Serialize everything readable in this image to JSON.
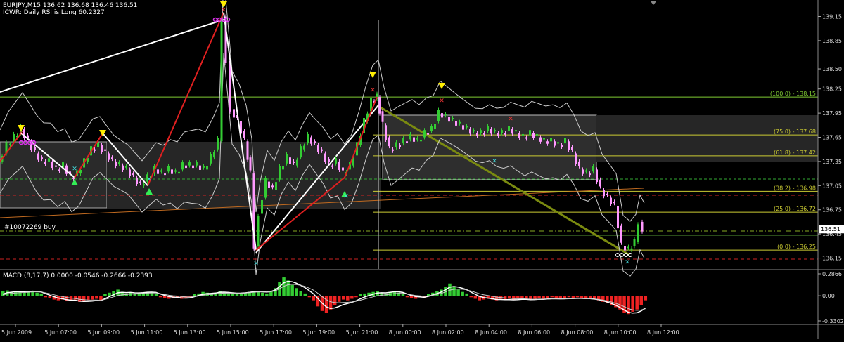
{
  "header": {
    "symbol_line": "EURJPY,M15  136.62 136.68 136.46 136.51",
    "indicator_line": "ICWR: Daily RSI is Long 60.2327",
    "order_label": "#10072269 buy"
  },
  "price_axis": {
    "ticks": [
      "139.15",
      "138.85",
      "138.50",
      "138.25",
      "137.95",
      "137.65",
      "137.35",
      "137.05",
      "136.75",
      "136.45",
      "136.15"
    ],
    "current_price": "136.51",
    "range": [
      136.05,
      139.32
    ]
  },
  "fib_levels": [
    {
      "label": "(100.0) - 138.15",
      "value": 138.15,
      "color": "#7fcc33"
    },
    {
      "label": "(75.0) - 137.68",
      "value": 137.68,
      "color": "#cccc33"
    },
    {
      "label": "(61.8) - 137.42",
      "value": 137.42,
      "color": "#cccc33"
    },
    {
      "label": "(38.2) - 136.98",
      "value": 136.98,
      "color": "#cccc33"
    },
    {
      "label": "(25.0) - 136.72",
      "value": 136.72,
      "color": "#cccc33"
    },
    {
      "label": "(0.0) - 136.25",
      "value": 136.25,
      "color": "#cccc33"
    }
  ],
  "macd": {
    "label": "MACD  (8,17,7) 0.0000 -0.0546 -0.2666 -0.2393",
    "ticks": [
      "0.2866",
      "0.00",
      "-0.3302"
    ],
    "range": [
      -0.3302,
      0.2866
    ]
  },
  "time_axis": {
    "labels": [
      "5 Jun 2009",
      "5 Jun 07:00",
      "5 Jun 09:00",
      "5 Jun 11:00",
      "5 Jun 13:00",
      "5 Jun 15:00",
      "5 Jun 17:00",
      "5 Jun 19:00",
      "5 Jun 21:00",
      "8 Jun 00:00",
      "8 Jun 02:00",
      "8 Jun 04:00",
      "8 Jun 06:00",
      "8 Jun 08:00",
      "8 Jun 10:00",
      "8 Jun 12:00"
    ]
  },
  "colors": {
    "background": "#000000",
    "bull_candle": "#33cc33",
    "bear_candle": "#ff99ff",
    "zigzag_up": "#ffffff",
    "zigzag_down": "#e02020",
    "macd_pos": "#33cc33",
    "macd_neg": "#ee2222",
    "arrow_down": "#ffee00",
    "arrow_up": "#33ee55",
    "marker_cross": "#44dddd"
  },
  "chart_data": {
    "type": "candlestick",
    "symbol": "EURJPY",
    "timeframe": "M15",
    "ohlc_last": {
      "open": 136.62,
      "high": 136.68,
      "low": 136.46,
      "close": 136.51
    },
    "close_path": [
      [
        0,
        137.35
      ],
      [
        12,
        137.55
      ],
      [
        22,
        137.65
      ],
      [
        32,
        137.75
      ],
      [
        42,
        137.6
      ],
      [
        52,
        137.45
      ],
      [
        62,
        137.35
      ],
      [
        72,
        137.35
      ],
      [
        82,
        137.25
      ],
      [
        92,
        137.3
      ],
      [
        102,
        137.15
      ],
      [
        112,
        137.2
      ],
      [
        122,
        137.35
      ],
      [
        132,
        137.5
      ],
      [
        142,
        137.55
      ],
      [
        152,
        137.45
      ],
      [
        162,
        137.35
      ],
      [
        172,
        137.3
      ],
      [
        182,
        137.25
      ],
      [
        192,
        137.15
      ],
      [
        202,
        137.05
      ],
      [
        212,
        137.15
      ],
      [
        222,
        137.25
      ],
      [
        232,
        137.2
      ],
      [
        242,
        137.25
      ],
      [
        252,
        137.2
      ],
      [
        262,
        137.3
      ],
      [
        272,
        137.3
      ],
      [
        282,
        137.3
      ],
      [
        292,
        137.25
      ],
      [
        302,
        137.4
      ],
      [
        312,
        137.6
      ],
      [
        318,
        139.15
      ],
      [
        324,
        138.6
      ],
      [
        330,
        138.0
      ],
      [
        340,
        137.85
      ],
      [
        350,
        137.6
      ],
      [
        358,
        137.2
      ],
      [
        364,
        136.3
      ],
      [
        370,
        136.7
      ],
      [
        380,
        137.1
      ],
      [
        390,
        137.0
      ],
      [
        400,
        137.25
      ],
      [
        410,
        137.4
      ],
      [
        420,
        137.3
      ],
      [
        430,
        137.5
      ],
      [
        440,
        137.65
      ],
      [
        450,
        137.55
      ],
      [
        460,
        137.45
      ],
      [
        470,
        137.3
      ],
      [
        480,
        137.35
      ],
      [
        490,
        137.2
      ],
      [
        500,
        137.3
      ],
      [
        510,
        137.55
      ],
      [
        520,
        137.85
      ],
      [
        530,
        138.1
      ],
      [
        538,
        138.15
      ],
      [
        546,
        137.8
      ],
      [
        556,
        137.5
      ],
      [
        566,
        137.55
      ],
      [
        576,
        137.6
      ],
      [
        586,
        137.65
      ],
      [
        596,
        137.6
      ],
      [
        606,
        137.7
      ],
      [
        616,
        137.75
      ],
      [
        626,
        137.95
      ],
      [
        636,
        137.9
      ],
      [
        646,
        137.85
      ],
      [
        656,
        137.8
      ],
      [
        666,
        137.75
      ],
      [
        676,
        137.7
      ],
      [
        686,
        137.7
      ],
      [
        696,
        137.75
      ],
      [
        706,
        137.7
      ],
      [
        716,
        137.7
      ],
      [
        726,
        137.75
      ],
      [
        736,
        137.7
      ],
      [
        746,
        137.65
      ],
      [
        756,
        137.7
      ],
      [
        766,
        137.65
      ],
      [
        776,
        137.6
      ],
      [
        786,
        137.6
      ],
      [
        796,
        137.55
      ],
      [
        806,
        137.6
      ],
      [
        816,
        137.45
      ],
      [
        826,
        137.25
      ],
      [
        836,
        137.2
      ],
      [
        846,
        137.25
      ],
      [
        856,
        137.0
      ],
      [
        866,
        136.9
      ],
      [
        876,
        136.8
      ],
      [
        886,
        136.3
      ],
      [
        896,
        136.25
      ],
      [
        904,
        136.35
      ],
      [
        910,
        136.6
      ],
      [
        916,
        136.51
      ]
    ],
    "zigzag": [
      [
        0,
        137.35
      ],
      [
        30,
        137.7
      ],
      [
        106,
        137.15
      ],
      [
        146,
        137.7
      ],
      [
        210,
        137.05
      ],
      [
        318,
        139.2
      ],
      [
        364,
        136.25
      ],
      [
        490,
        137.15
      ],
      [
        536,
        138.15
      ]
    ],
    "macd_hist": [
      0.06,
      0.07,
      0.05,
      0.06,
      0.05,
      0.04,
      0.05,
      0.06,
      0.04,
      0.03,
      -0.02,
      -0.03,
      -0.05,
      -0.06,
      -0.05,
      -0.07,
      -0.06,
      -0.05,
      -0.08,
      -0.07,
      -0.06,
      -0.05,
      -0.04,
      -0.06,
      0.02,
      0.04,
      0.06,
      0.08,
      0.05,
      0.03,
      0.04,
      0.02,
      0.03,
      0.04,
      0.05,
      0.04,
      0.03,
      -0.02,
      -0.03,
      -0.04,
      -0.03,
      -0.02,
      -0.04,
      -0.03,
      -0.02,
      0.02,
      0.03,
      0.05,
      0.04,
      0.03,
      0.04,
      0.06,
      0.04,
      0.03,
      0.02,
      0.02,
      0.03,
      0.04,
      0.05,
      0.06,
      0.05,
      0.04,
      0.03,
      0.06,
      0.1,
      0.18,
      0.24,
      0.2,
      0.14,
      0.1,
      0.06,
      0.03,
      -0.02,
      -0.06,
      -0.14,
      -0.2,
      -0.22,
      -0.18,
      -0.12,
      -0.08,
      -0.05,
      -0.06,
      -0.04,
      -0.02,
      0.02,
      0.03,
      0.04,
      0.05,
      0.06,
      0.04,
      0.03,
      0.05,
      0.06,
      0.04,
      0.02,
      -0.02,
      -0.03,
      -0.04,
      -0.02,
      -0.03,
      0.02,
      0.04,
      0.06,
      0.08,
      0.12,
      0.16,
      0.12,
      0.08,
      0.05,
      0.03,
      -0.02,
      -0.04,
      -0.06,
      -0.05,
      -0.04,
      -0.05,
      -0.06,
      -0.04,
      -0.05,
      -0.04,
      -0.05,
      -0.04,
      -0.03,
      -0.04,
      -0.05,
      -0.04,
      -0.03,
      -0.04,
      -0.03,
      -0.02,
      -0.03,
      -0.04,
      -0.03,
      -0.02,
      -0.03,
      -0.02,
      -0.03,
      -0.04,
      -0.03,
      -0.05,
      -0.06,
      -0.08,
      -0.1,
      -0.12,
      -0.15,
      -0.18,
      -0.22,
      -0.24,
      -0.21,
      -0.18,
      -0.12,
      -0.06
    ]
  }
}
